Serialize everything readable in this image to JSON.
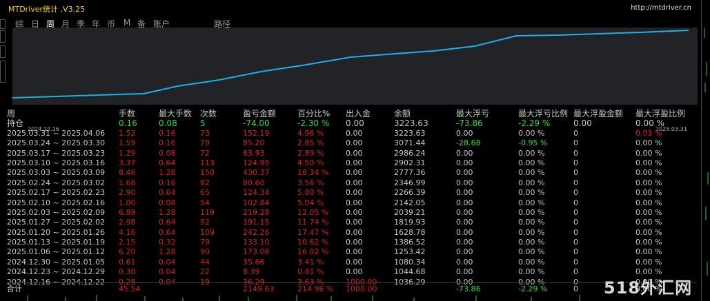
{
  "title": "MTDriver统计 ,V3.25",
  "url": "http://mtdriver.cn",
  "tabs": [
    "综",
    "日",
    "周",
    "月",
    "季",
    "年",
    "币",
    "M",
    "备",
    "账户",
    "路径"
  ],
  "active_tab": "周",
  "chart": {
    "x_start": "2024.12.16",
    "x_end": "2025.03.31",
    "line_color": "#1fb0ea"
  },
  "headers": {
    "period": "周",
    "lots": "手数",
    "max_lots": "最大手数",
    "trades": "次数",
    "pnl": "盈亏金额",
    "pct": "百分比%",
    "deposit": "出入金",
    "balance": "余额",
    "max_float_loss": "最大浮亏",
    "max_float_loss_pct": "最大浮亏比例",
    "max_float_profit": "最大浮盈金额",
    "max_float_profit_pct": "最大浮盈比例"
  },
  "position": {
    "label": "持仓",
    "lots": "0.16",
    "max_lots": "0.08",
    "trades": "5",
    "pnl": "-74.00",
    "pct": "-2.30 %",
    "deposit": "0.00",
    "balance": "3223.63",
    "max_float_loss": "-73.86",
    "max_float_loss_pct": "-2.29 %",
    "max_float_profit": "0.00",
    "max_float_profit_pct": "0.00 %"
  },
  "rows": [
    {
      "period": "2025.03.31 ~ 2025.04.06",
      "lots": "1.52",
      "max_lots": "0.16",
      "trades": "73",
      "pnl": "152.19",
      "pct": "4.96 %",
      "deposit": "0.00",
      "balance": "3223.63",
      "mfl": "0.00",
      "mflp": "0.00 %",
      "mfp": "0",
      "mfpp": "0.03 %"
    },
    {
      "period": "2025.03.24 ~ 2025.03.30",
      "lots": "1.59",
      "max_lots": "0.16",
      "trades": "79",
      "pnl": "85.20",
      "pct": "2.85 %",
      "deposit": "0.00",
      "balance": "3071.44",
      "mfl": "-28.68",
      "mflp": "-0.95 %",
      "mfp": "0",
      "mfpp": "0.00 %"
    },
    {
      "period": "2025.03.17 ~ 2025.03.23",
      "lots": "1.29",
      "max_lots": "0.08",
      "trades": "72",
      "pnl": "83.93",
      "pct": "2.89 %",
      "deposit": "0.00",
      "balance": "2986.24",
      "mfl": "0.00",
      "mflp": "0.00 %",
      "mfp": "0",
      "mfpp": "0.00 %"
    },
    {
      "period": "2025.03.10 ~ 2025.03.16",
      "lots": "3.37",
      "max_lots": "0.64",
      "trades": "113",
      "pnl": "124.95",
      "pct": "4.50 %",
      "deposit": "0.00",
      "balance": "2902.31",
      "mfl": "0.00",
      "mflp": "0.00 %",
      "mfp": "0",
      "mfpp": "0.00 %"
    },
    {
      "period": "2025.03.03 ~ 2025.03.09",
      "lots": "8.46",
      "max_lots": "1.28",
      "trades": "150",
      "pnl": "430.37",
      "pct": "18.34 %",
      "deposit": "0.00",
      "balance": "2777.36",
      "mfl": "0.00",
      "mflp": "0.00 %",
      "mfp": "0",
      "mfpp": "0.00 %"
    },
    {
      "period": "2025.02.24 ~ 2025.03.02",
      "lots": "1.68",
      "max_lots": "0.16",
      "trades": "82",
      "pnl": "80.60",
      "pct": "3.56 %",
      "deposit": "0.00",
      "balance": "2346.99",
      "mfl": "0.00",
      "mflp": "0.00 %",
      "mfp": "0",
      "mfpp": "0.00 %"
    },
    {
      "period": "2025.02.17 ~ 2025.02.23",
      "lots": "2.90",
      "max_lots": "0.64",
      "trades": "65",
      "pnl": "124.34",
      "pct": "5.80 %",
      "deposit": "0.00",
      "balance": "2266.39",
      "mfl": "0.00",
      "mflp": "0.00 %",
      "mfp": "0",
      "mfpp": "0.00 %"
    },
    {
      "period": "2025.02.10 ~ 2025.02.16",
      "lots": "1.00",
      "max_lots": "0.08",
      "trades": "54",
      "pnl": "102.84",
      "pct": "5.04 %",
      "deposit": "0.00",
      "balance": "2142.05",
      "mfl": "0.00",
      "mflp": "0.00 %",
      "mfp": "0",
      "mfpp": "0.00 %"
    },
    {
      "period": "2025.02.03 ~ 2025.02.09",
      "lots": "6.89",
      "max_lots": "1.28",
      "trades": "119",
      "pnl": "219.28",
      "pct": "12.05 %",
      "deposit": "0.00",
      "balance": "2039.21",
      "mfl": "0.00",
      "mflp": "0.00 %",
      "mfp": "0",
      "mfpp": "0.00 %"
    },
    {
      "period": "2025.01.27 ~ 2025.02.02",
      "lots": "2.98",
      "max_lots": "0.64",
      "trades": "92",
      "pnl": "191.15",
      "pct": "11.74 %",
      "deposit": "0.00",
      "balance": "1819.93",
      "mfl": "0.00",
      "mflp": "0.00 %",
      "mfp": "0",
      "mfpp": "0.00 %"
    },
    {
      "period": "2025.01.20 ~ 2025.01.26",
      "lots": "4.16",
      "max_lots": "0.64",
      "trades": "109",
      "pnl": "242.26",
      "pct": "17.47 %",
      "deposit": "0.00",
      "balance": "1628.78",
      "mfl": "0.00",
      "mflp": "0.00 %",
      "mfp": "0",
      "mfpp": "0.00 %"
    },
    {
      "period": "2025.01.13 ~ 2025.01.19",
      "lots": "2.15",
      "max_lots": "0.32",
      "trades": "79",
      "pnl": "133.10",
      "pct": "10.62 %",
      "deposit": "0.00",
      "balance": "1386.52",
      "mfl": "0.00",
      "mflp": "0.00 %",
      "mfp": "0",
      "mfpp": "0.00 %"
    },
    {
      "period": "2025.01.06 ~ 2025.01.12",
      "lots": "6.20",
      "max_lots": "1.28",
      "trades": "90",
      "pnl": "173.08",
      "pct": "16.02 %",
      "deposit": "0.00",
      "balance": "1253.42",
      "mfl": "0.00",
      "mflp": "0.00 %",
      "mfp": "0",
      "mfpp": "0.00 %"
    },
    {
      "period": "2024.12.30 ~ 2025.01.05",
      "lots": "0.61",
      "max_lots": "0.04",
      "trades": "44",
      "pnl": "35.66",
      "pct": "3.41 %",
      "deposit": "0.00",
      "balance": "1080.34",
      "mfl": "0.00",
      "mflp": "0.00 %",
      "mfp": "0",
      "mfpp": "0.00 %"
    },
    {
      "period": "2024.12.23 ~ 2024.12.29",
      "lots": "0.30",
      "max_lots": "0.04",
      "trades": "22",
      "pnl": "8.39",
      "pct": "0.81 %",
      "deposit": "0.00",
      "balance": "1044.68",
      "mfl": "0.00",
      "mflp": "0.00 %",
      "mfp": "0",
      "mfpp": "0.00 %"
    },
    {
      "period": "2024.12.16 ~ 2024.12.22",
      "lots": "0.28",
      "max_lots": "0.04",
      "trades": "19",
      "pnl": "36.29",
      "pct": "3.63 %",
      "deposit": "1000.00",
      "balance": "1036.29",
      "mfl": "0.00",
      "mflp": "0.00 %",
      "mfp": "0",
      "mfpp": "0.00 %"
    }
  ],
  "total": {
    "label": "合计",
    "lots": "45.54",
    "pnl": "2149.63",
    "pct": "214.96 %",
    "deposit": "1000.00",
    "mfl": "-73.86",
    "mflp": "-2.29 %",
    "mfp": "0",
    "mfpp": "0.00 %"
  },
  "watermark": "518外汇网"
}
